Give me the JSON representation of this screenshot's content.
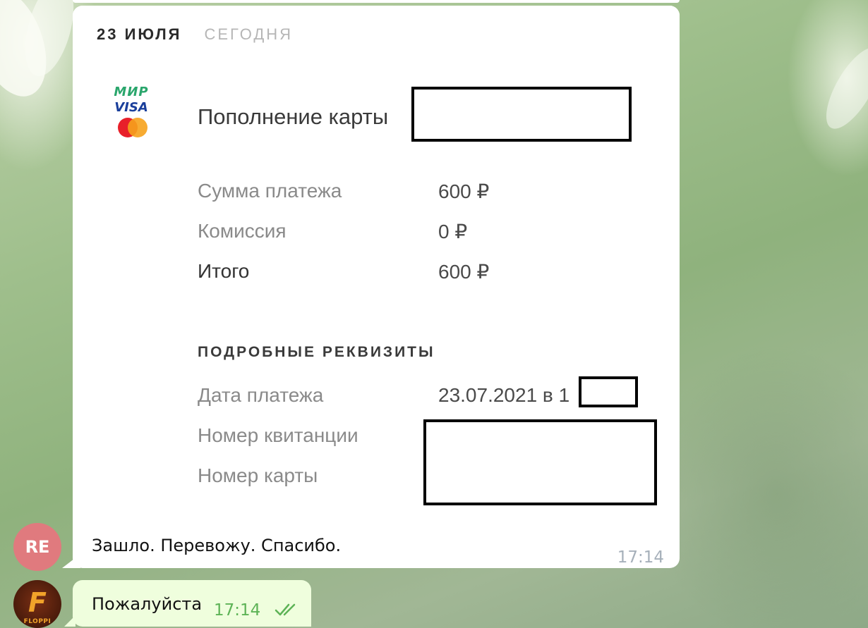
{
  "message_in": {
    "receipt": {
      "date": "23 ИЮЛЯ",
      "date_relative": "СЕГОДНЯ",
      "logos": {
        "mir": "МИР",
        "visa": "VISA",
        "mastercard": "mastercard"
      },
      "title": "Пополнение карты",
      "amount_rows": [
        {
          "label": "Сумма платежа",
          "value": "600 ₽"
        },
        {
          "label": "Комиссия",
          "value": "0 ₽"
        },
        {
          "label": "Итого",
          "value": "600 ₽"
        }
      ],
      "details_heading": "ПОДРОБНЫЕ РЕКВИЗИТЫ",
      "detail_rows": [
        {
          "label": "Дата платежа",
          "value": "23.07.2021 в 1"
        },
        {
          "label": "Номер квитанции",
          "value": ""
        },
        {
          "label": "Номер карты",
          "value": ""
        }
      ]
    },
    "caption": "Зашло. Перевожу. Спасибо.",
    "time": "17:14",
    "avatar_initials": "RE"
  },
  "message_out": {
    "text": "Пожалуйста",
    "time": "17:14",
    "status_icon": "double-check-icon",
    "avatar_label": "FLOPPI"
  },
  "colors": {
    "avatar_re": "#e07a7e",
    "outgoing_bubble": "#effedd",
    "outgoing_time": "#5db356",
    "incoming_time": "#a6b0ba"
  }
}
